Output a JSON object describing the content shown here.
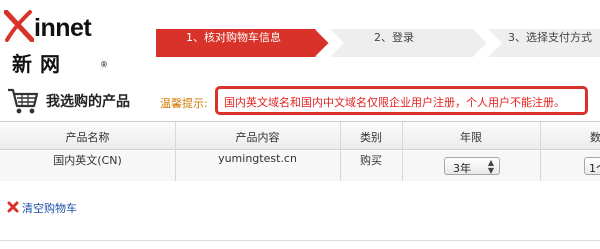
{
  "logo": {
    "text": "innet",
    "cn": "新网"
  },
  "steps": [
    {
      "label": "1、核对购物车信息",
      "active": true
    },
    {
      "label": "2、登录",
      "active": false
    },
    {
      "label": "3、选择支付方式",
      "active": false
    }
  ],
  "header": {
    "title": "我选购的产品",
    "notice_label": "温馨提示:",
    "notice_text": "国内英文域名和国内中文域名仅限企业用户注册，个人用户不能注册。"
  },
  "table": {
    "columns": [
      "产品名称",
      "产品内容",
      "类别",
      "年限",
      "数"
    ],
    "rows": [
      {
        "name": "国内英文(CN)",
        "content": "yumingtest.cn",
        "type": "购买",
        "years": "3年",
        "qty": "1个"
      }
    ]
  },
  "actions": {
    "clear_cart": "清空购物车"
  },
  "colors": {
    "accent_red": "#d9322a",
    "notice_orange": "#d27a00",
    "link_blue": "#1f4fa8"
  }
}
